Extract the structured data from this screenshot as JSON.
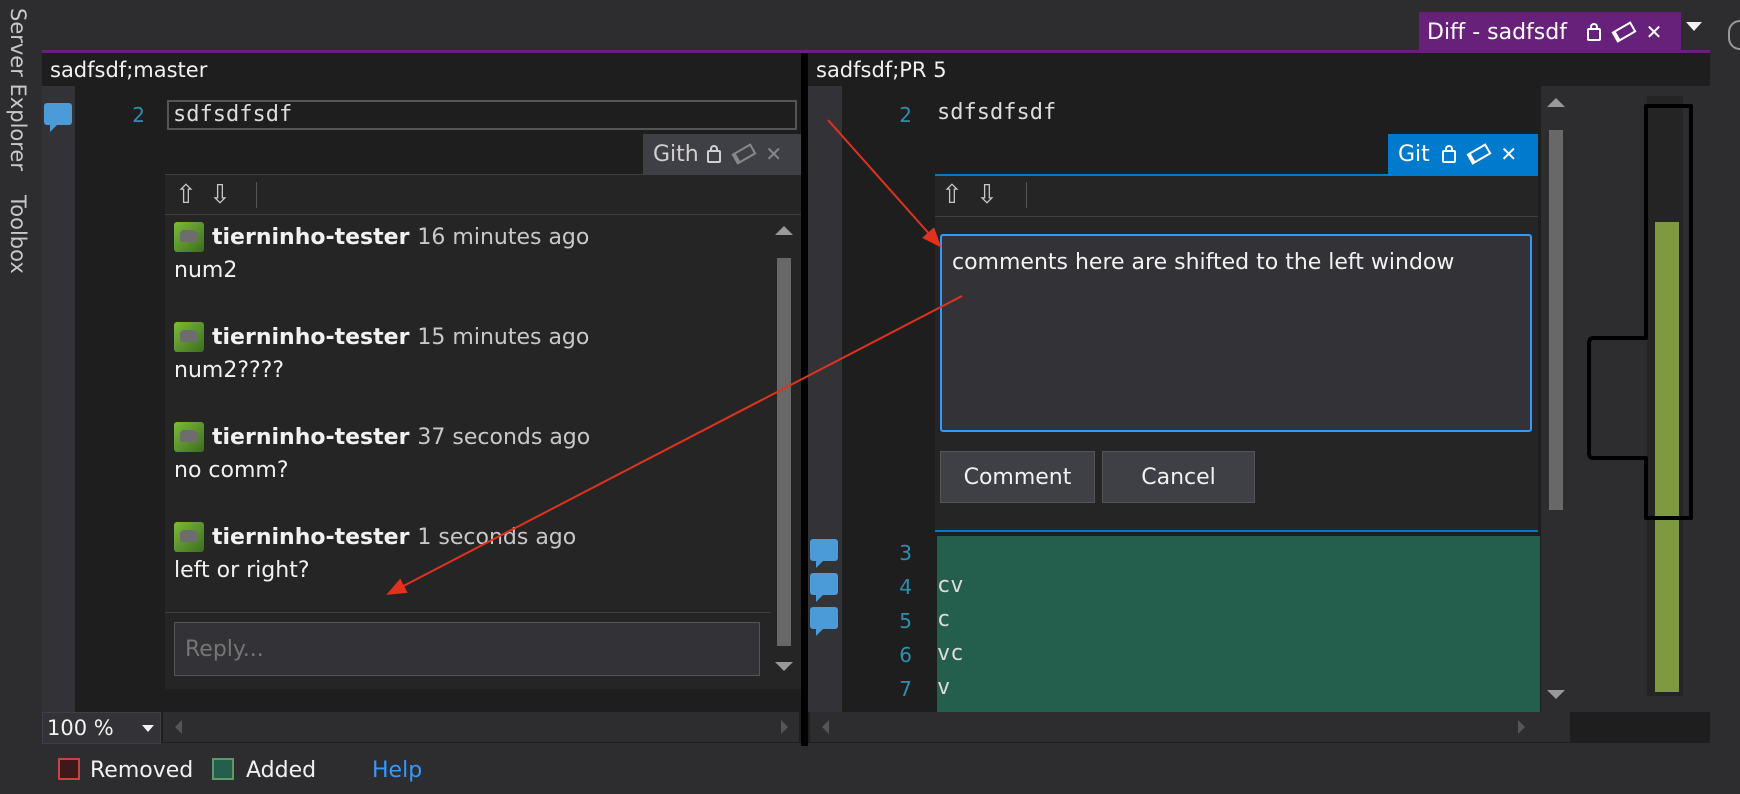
{
  "toolbar_left": {
    "server_explorer": "Server Explorer",
    "toolbox": "Toolbox"
  },
  "tab": {
    "title": "Diff - sadfsdf",
    "close": "✕"
  },
  "left_pane": {
    "file_label": "sadfsdf;master",
    "line_number": "2",
    "line_code": "sdfsdfsdf",
    "popup_title": "Gith",
    "comments": [
      {
        "user": "tierninho-tester",
        "time": "16 minutes ago",
        "body": "num2"
      },
      {
        "user": "tierninho-tester",
        "time": "15 minutes ago",
        "body": "num2????"
      },
      {
        "user": "tierninho-tester",
        "time": "37 seconds ago",
        "body": "no comm?"
      },
      {
        "user": "tierninho-tester",
        "time": "1 seconds ago",
        "body": "left or right?"
      }
    ],
    "reply_placeholder": "Reply...",
    "zoom": "100 %"
  },
  "right_pane": {
    "file_label": "sadfsdf;PR 5",
    "line_number": "2",
    "line_code": "sdfsdfsdf",
    "popup_title": "Git",
    "comment_text": "comments here are shifted to the left window",
    "comment_button": "Comment",
    "cancel_button": "Cancel",
    "added_lines": [
      {
        "num": "3",
        "code": ""
      },
      {
        "num": "4",
        "code": "cv"
      },
      {
        "num": "5",
        "code": "c"
      },
      {
        "num": "6",
        "code": "vc"
      },
      {
        "num": "7",
        "code": "v"
      }
    ]
  },
  "legend": {
    "removed": "Removed",
    "added": "Added",
    "help": "Help"
  },
  "colors": {
    "accent": "#68217a",
    "popup_active": "#007acc",
    "added_bg": "#245e4c",
    "annotation_arrow": "#e0321f"
  }
}
